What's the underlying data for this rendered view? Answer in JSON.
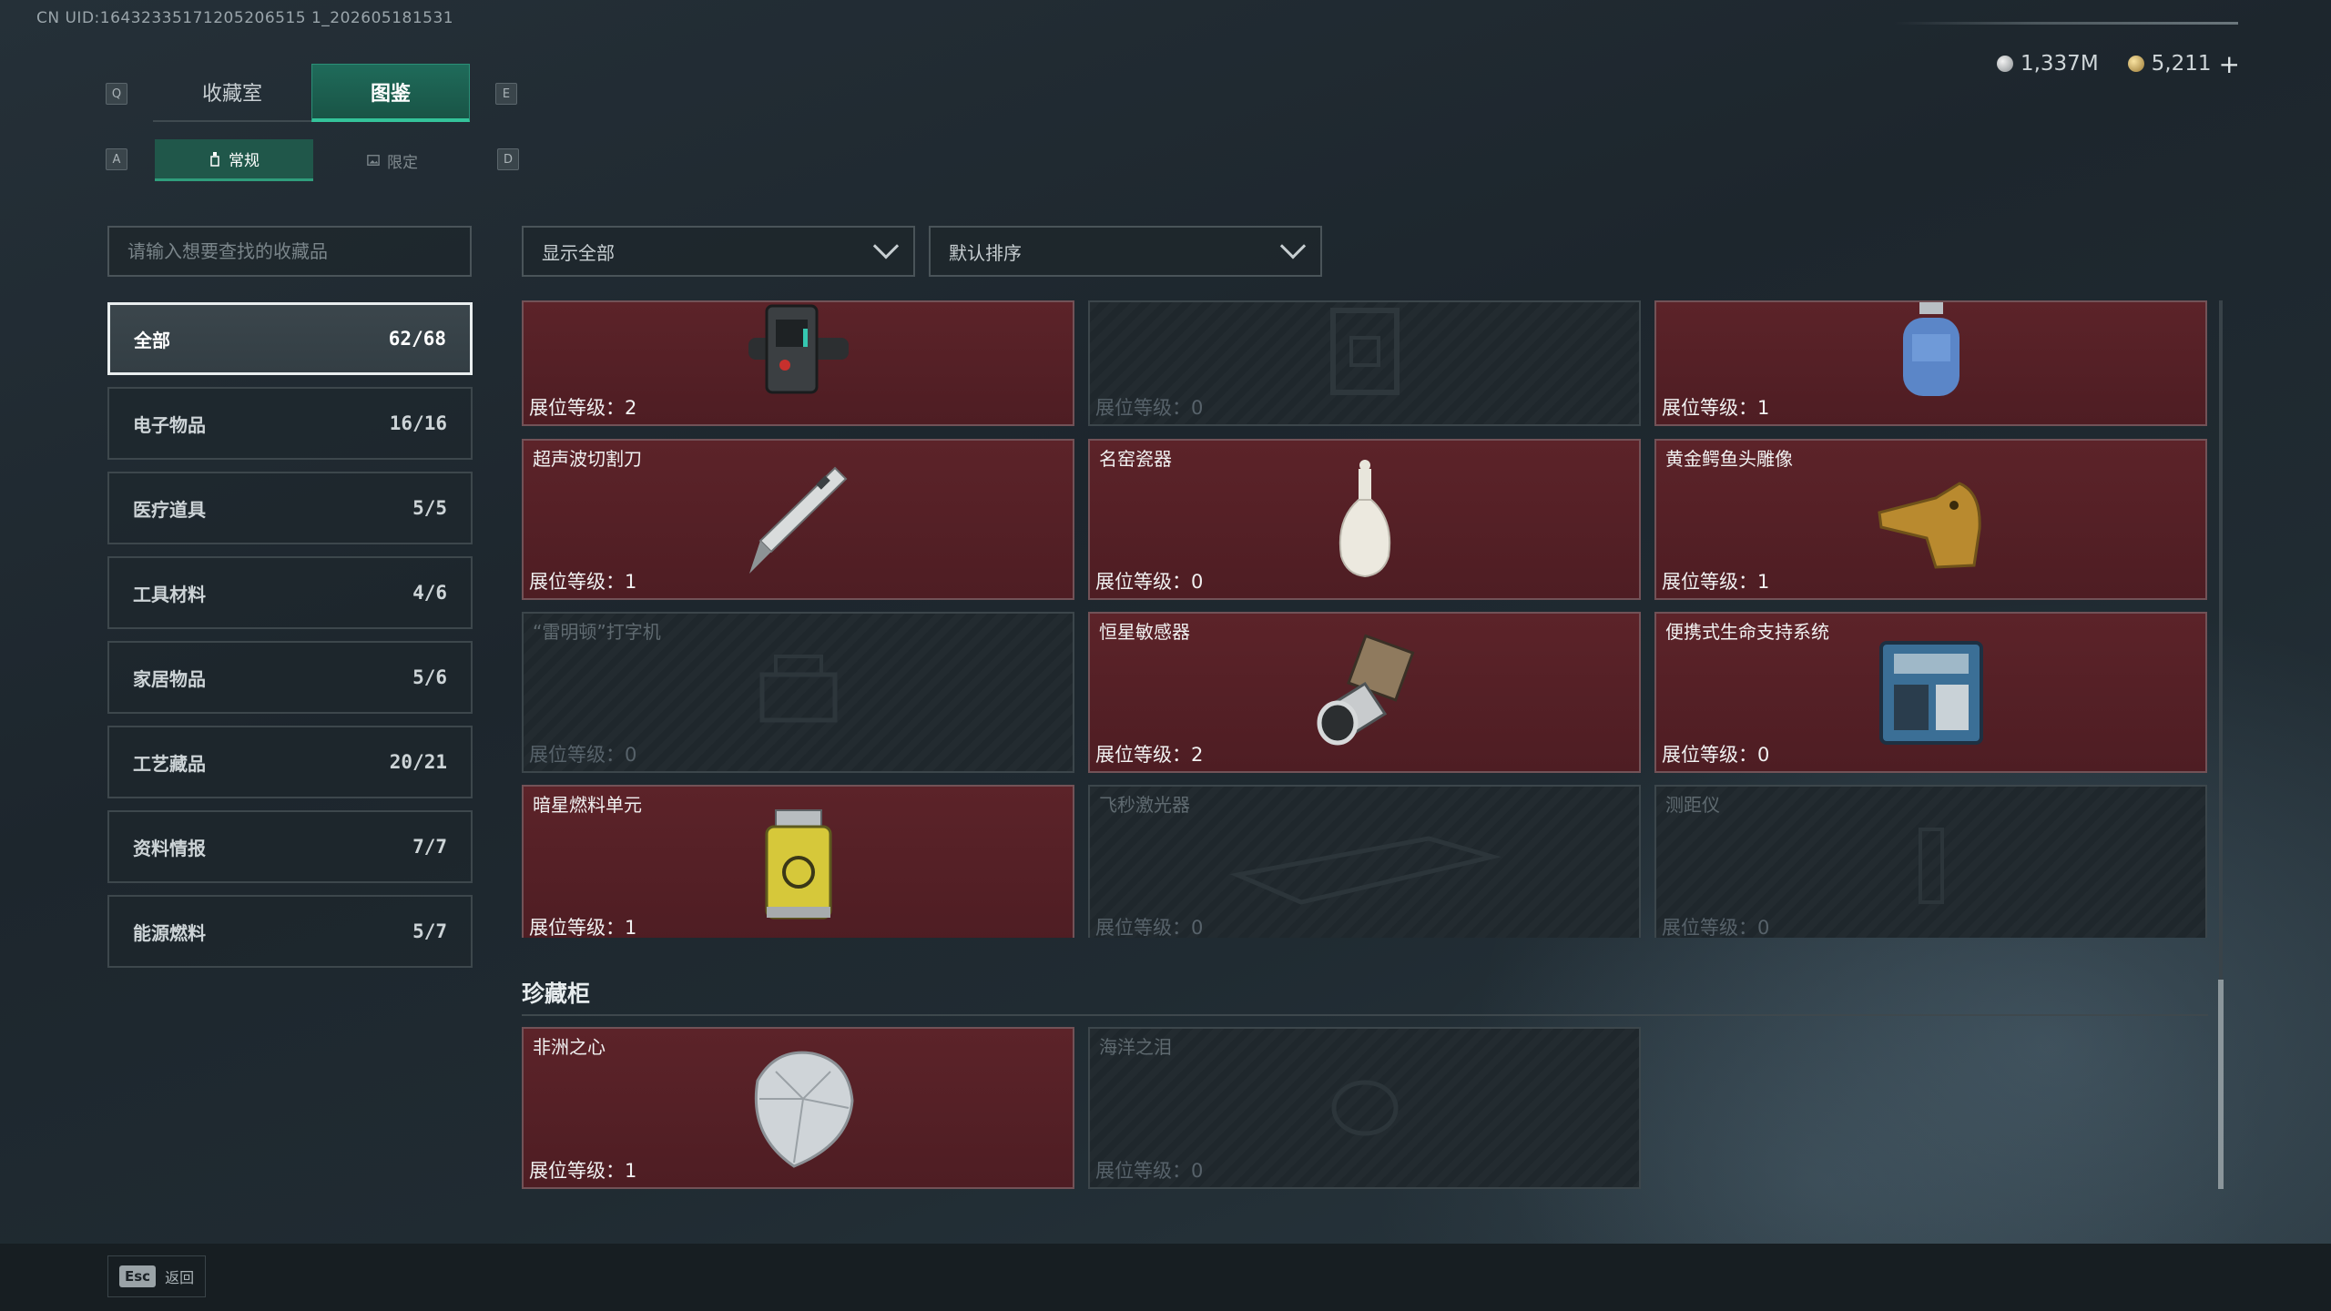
{
  "uid_text": "CN UID:16432335171205206515 1_202605181531",
  "tabs": [
    {
      "label": "收藏室",
      "active": false
    },
    {
      "label": "图鉴",
      "active": true
    }
  ],
  "tab_keys": {
    "left": "Q",
    "right": "E"
  },
  "subtabs": [
    {
      "label": "常规",
      "active": true
    },
    {
      "label": "限定",
      "active": false
    }
  ],
  "subtab_keys": {
    "left": "A",
    "right": "D"
  },
  "currency": {
    "silver": "1,337M",
    "gold": "5,211",
    "add_label": "+"
  },
  "search": {
    "placeholder": "请输入想要查找的收藏品"
  },
  "filters": {
    "show": "显示全部",
    "sort": "默认排序"
  },
  "categories": [
    {
      "label": "全部",
      "count": "62/68",
      "active": true
    },
    {
      "label": "电子物品",
      "count": "16/16"
    },
    {
      "label": "医疗道具",
      "count": "5/5"
    },
    {
      "label": "工具材料",
      "count": "4/6"
    },
    {
      "label": "家居物品",
      "count": "5/6"
    },
    {
      "label": "工艺藏品",
      "count": "20/21"
    },
    {
      "label": "资料情报",
      "count": "7/7"
    },
    {
      "label": "能源燃料",
      "count": "5/7"
    }
  ],
  "items": [
    {
      "name": "",
      "level": "展位等级：2",
      "owned": true,
      "icon": "watch-device-icon"
    },
    {
      "name": "",
      "level": "展位等级：0",
      "owned": false,
      "icon": "box-icon"
    },
    {
      "name": "",
      "level": "展位等级：1",
      "owned": true,
      "icon": "gas-canister-icon"
    },
    {
      "name": "超声波切割刀",
      "level": "展位等级：1",
      "owned": true,
      "icon": "cutting-knife-icon"
    },
    {
      "name": "名窑瓷器",
      "level": "展位等级：0",
      "owned": true,
      "icon": "porcelain-vase-icon"
    },
    {
      "name": "黄金鳄鱼头雕像",
      "level": "展位等级：1",
      "owned": true,
      "icon": "gold-crocodile-icon"
    },
    {
      "name": "“雷明顿”打字机",
      "level": "展位等级：0",
      "owned": false,
      "icon": "typewriter-icon"
    },
    {
      "name": "恒星敏感器",
      "level": "展位等级：2",
      "owned": true,
      "icon": "star-sensor-icon"
    },
    {
      "name": "便携式生命支持系统",
      "level": "展位等级：0",
      "owned": true,
      "icon": "life-support-icon"
    },
    {
      "name": "暗星燃料单元",
      "level": "展位等级：1",
      "owned": true,
      "icon": "fuel-cell-icon"
    },
    {
      "name": "飞秒激光器",
      "level": "展位等级：0",
      "owned": false,
      "icon": "laser-icon"
    },
    {
      "name": "测距仪",
      "level": "展位等级：0",
      "owned": false,
      "icon": "rangefinder-icon"
    }
  ],
  "section": {
    "title": "珍藏柜"
  },
  "treasures": [
    {
      "name": "非洲之心",
      "level": "展位等级：1",
      "owned": true,
      "icon": "diamond-icon"
    },
    {
      "name": "海洋之泪",
      "level": "展位等级：0",
      "owned": false,
      "icon": "gem-icon"
    }
  ],
  "footer": {
    "key": "Esc",
    "label": "返回"
  }
}
